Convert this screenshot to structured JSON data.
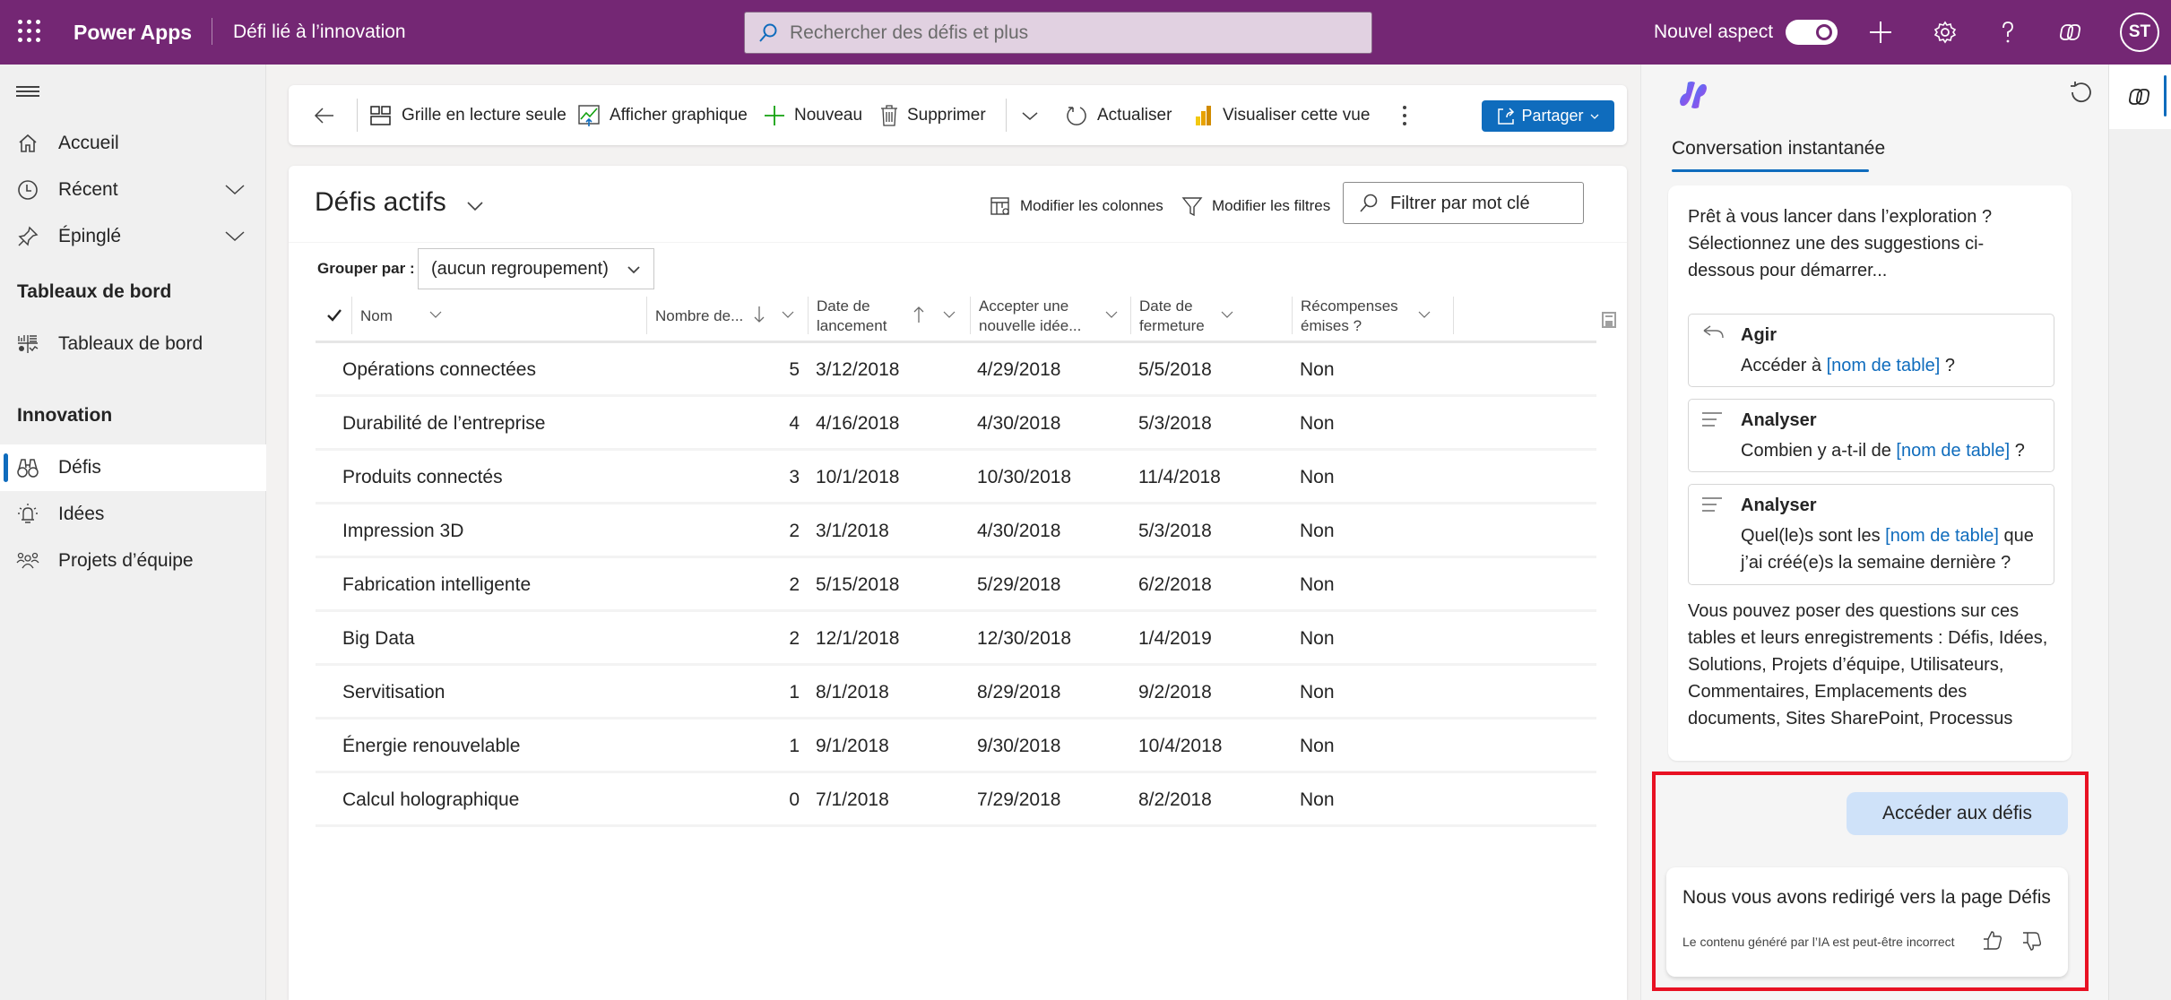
{
  "header": {
    "app_name": "Power Apps",
    "environment": "Défi lié à l’innovation",
    "search_placeholder": "Rechercher des défis et plus",
    "new_look_label": "Nouvel aspect",
    "new_look_enabled": true,
    "avatar_initials": "ST",
    "brand_color": "#742774"
  },
  "sidebar": {
    "items": [
      {
        "label": "Accueil",
        "icon": "home-icon"
      },
      {
        "label": "Récent",
        "icon": "clock-icon",
        "expandable": true
      },
      {
        "label": "Épinglé",
        "icon": "pin-icon",
        "expandable": true
      }
    ],
    "sections": [
      {
        "title": "Tableaux de bord",
        "items": [
          {
            "label": "Tableaux de bord",
            "icon": "dashboard-icon"
          }
        ]
      },
      {
        "title": "Innovation",
        "items": [
          {
            "label": "Défis",
            "icon": "binoculars-icon",
            "active": true
          },
          {
            "label": "Idées",
            "icon": "lightbulb-icon"
          },
          {
            "label": "Projets d’équipe",
            "icon": "team-icon"
          }
        ]
      }
    ]
  },
  "commandbar": {
    "readonly_grid": "Grille en lecture seule",
    "show_chart": "Afficher graphique",
    "new": "Nouveau",
    "delete": "Supprimer",
    "refresh": "Actualiser",
    "visualize": "Visualiser cette vue",
    "share": "Partager"
  },
  "view": {
    "title": "Défis actifs",
    "edit_columns": "Modifier les colonnes",
    "edit_filters": "Modifier les filtres",
    "keyword_placeholder": "Filtrer par mot clé",
    "group_by_label": "Grouper par :",
    "group_by_value": "(aucun regroupement)",
    "columns": [
      {
        "line1": "Nom",
        "line2": ""
      },
      {
        "line1": "Nombre de...",
        "line2": "",
        "sort": "desc"
      },
      {
        "line1": "Date de",
        "line2": "lancement",
        "sort": "asc"
      },
      {
        "line1": "Accepter une",
        "line2": "nouvelle idée..."
      },
      {
        "line1": "Date de",
        "line2": "fermeture"
      },
      {
        "line1": "Récompenses",
        "line2": "émises ?"
      }
    ],
    "rows": [
      {
        "name": "Opérations connectées",
        "count": "5",
        "launch": "3/12/2018",
        "accept": "4/29/2018",
        "close": "5/5/2018",
        "rewards": "Non"
      },
      {
        "name": "Durabilité de l’entreprise",
        "count": "4",
        "launch": "4/16/2018",
        "accept": "4/30/2018",
        "close": "5/3/2018",
        "rewards": "Non"
      },
      {
        "name": "Produits connectés",
        "count": "3",
        "launch": "10/1/2018",
        "accept": "10/30/2018",
        "close": "11/4/2018",
        "rewards": "Non"
      },
      {
        "name": "Impression 3D",
        "count": "2",
        "launch": "3/1/2018",
        "accept": "4/30/2018",
        "close": "5/3/2018",
        "rewards": "Non"
      },
      {
        "name": "Fabrication intelligente",
        "count": "2",
        "launch": "5/15/2018",
        "accept": "5/29/2018",
        "close": "6/2/2018",
        "rewards": "Non"
      },
      {
        "name": "Big Data",
        "count": "2",
        "launch": "12/1/2018",
        "accept": "12/30/2018",
        "close": "1/4/2019",
        "rewards": "Non"
      },
      {
        "name": "Servitisation",
        "count": "1",
        "launch": "8/1/2018",
        "accept": "8/29/2018",
        "close": "9/2/2018",
        "rewards": "Non"
      },
      {
        "name": "Énergie renouvelable",
        "count": "1",
        "launch": "9/1/2018",
        "accept": "9/30/2018",
        "close": "10/4/2018",
        "rewards": "Non"
      },
      {
        "name": "Calcul holographique",
        "count": "0",
        "launch": "7/1/2018",
        "accept": "7/29/2018",
        "close": "8/2/2018",
        "rewards": "Non"
      }
    ]
  },
  "copilot": {
    "tab": "Conversation instantanée",
    "intro": "Prêt à vous lancer dans l’exploration ? Sélectionnez une des suggestions ci-dessous pour démarrer...",
    "suggestions": [
      {
        "title": "Agir",
        "before": "Accéder à ",
        "link": "[nom de table]",
        "after": " ?"
      },
      {
        "title": "Analyser",
        "before": "Combien y a-t-il de ",
        "link": "[nom de table]",
        "after": " ?"
      },
      {
        "title": "Analyser",
        "before": "Quel(le)s sont les ",
        "link": "[nom de table]",
        "after": " que j’ai créé(e)s la semaine dernière ?"
      }
    ],
    "outro": "Vous pouvez poser des questions sur ces tables et leurs enregistrements : Défis, Idées, Solutions, Projets d’équipe, Utilisateurs, Commentaires, Emplacements des documents, Sites SharePoint, Processus",
    "user_message": "Accéder aux défis",
    "bot_message": "Nous vous avons redirigé vers la page Défis",
    "disclaimer": "Le contenu généré par l’IA est peut-être incorrect"
  }
}
